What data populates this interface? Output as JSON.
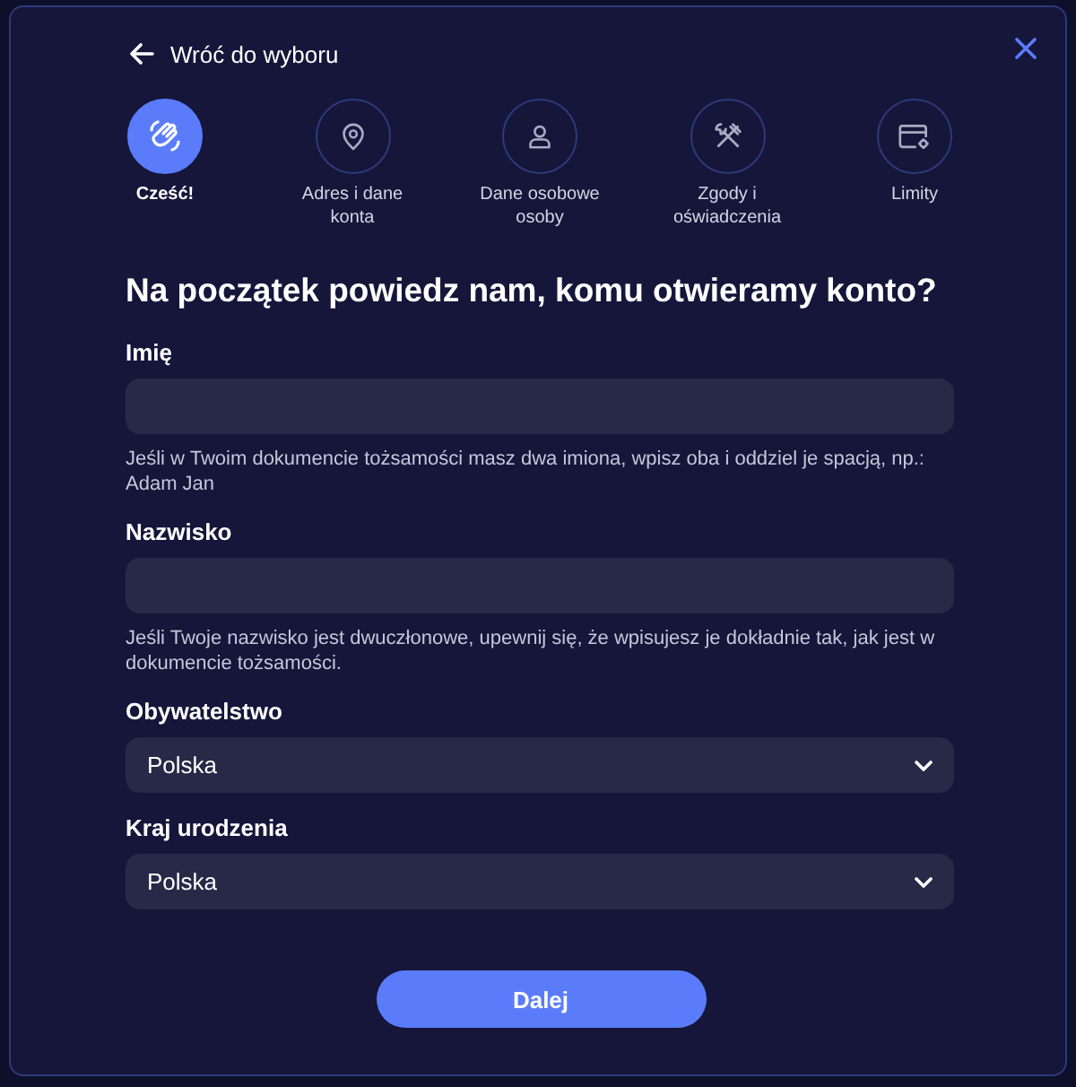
{
  "header": {
    "back_link": "Wróć do wyboru"
  },
  "steps": [
    {
      "label": "Cześć!",
      "selected": true
    },
    {
      "label": "Adres i dane konta",
      "selected": false
    },
    {
      "label": "Dane osobowe osoby",
      "selected": false
    },
    {
      "label": "Zgody i oświadczenia",
      "selected": false
    },
    {
      "label": "Limity",
      "selected": false
    }
  ],
  "title": "Na początek powiedz nam, komu otwieramy konto?",
  "fields": [
    {
      "kind": "text",
      "label": "Imię",
      "hint": "Jeśli w Twoim dokumencie tożsamości masz dwa imiona, wpisz oba i oddziel je spacją, np.: Adam Jan"
    },
    {
      "kind": "text",
      "label": "Nazwisko",
      "hint": "Jeśli Twoje nazwisko jest dwuczłonowe, upewnij się, że wpisujesz je dokładnie tak, jak jest w dokumencie tożsamości."
    },
    {
      "kind": "select",
      "label": "Obywatelstwo",
      "value": "Polska"
    },
    {
      "kind": "select",
      "label": "Kraj urodzenia",
      "value": "Polska"
    }
  ],
  "submit": "Dalej"
}
